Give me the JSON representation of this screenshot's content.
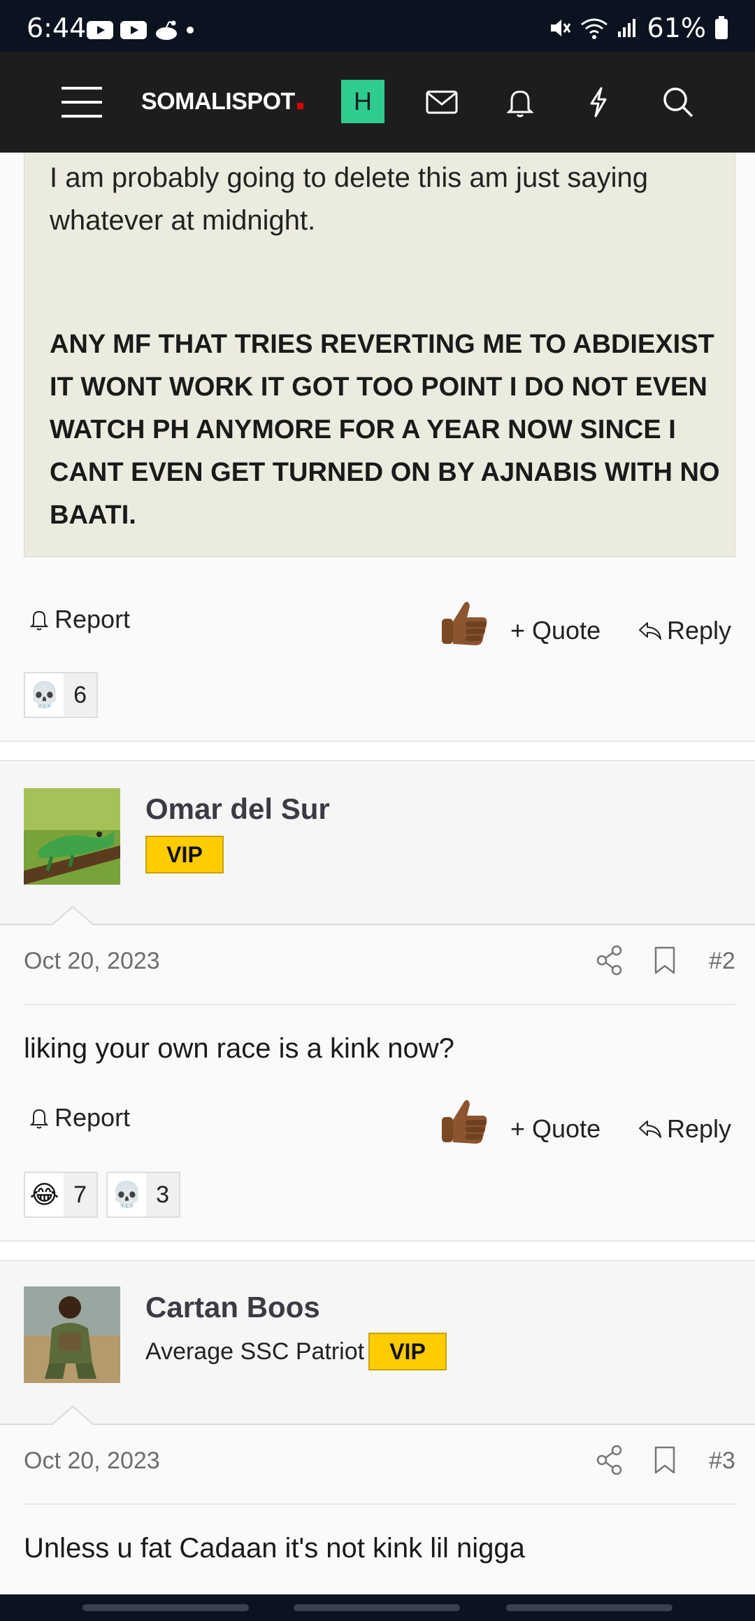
{
  "status_bar": {
    "time": "6:44",
    "battery": "61%",
    "left_icons": [
      "youtube-icon",
      "youtube-icon",
      "reddit-icon",
      "dot-icon"
    ],
    "right_icons": [
      "mute-icon",
      "wifi-icon",
      "signal-icon",
      "battery-icon"
    ]
  },
  "header": {
    "brand": "SOMALISPOT",
    "badge": "H",
    "icons": [
      "menu-icon",
      "mail-icon",
      "bell-icon",
      "lightning-icon",
      "search-icon"
    ]
  },
  "post1": {
    "text_plain": "I am probably going to delete this am just saying whatever at midnight.",
    "text_bold": "ANY MF THAT TRIES REVERTING ME TO ABDIEXIST IT WONT WORK IT GOT TOO POINT I DO NOT EVEN WATCH PH ANYMORE FOR A YEAR NOW SINCE I CANT EVEN GET TURNED ON BY AJNABIS WITH NO BAATI.",
    "actions": {
      "report": "Report",
      "quote": "Quote",
      "reply": "Reply"
    },
    "reactions": [
      {
        "emoji": "💀",
        "count": "6"
      }
    ]
  },
  "post2": {
    "username": "Omar del Sur",
    "badge": "VIP",
    "date": "Oct 20, 2023",
    "number": "#2",
    "text": "liking your own race is a kink now?",
    "actions": {
      "report": "Report",
      "quote": "Quote",
      "reply": "Reply"
    },
    "reactions": [
      {
        "emoji": "😂",
        "count": "7"
      },
      {
        "emoji": "💀",
        "count": "3"
      }
    ]
  },
  "post3": {
    "username": "Cartan Boos",
    "user_title": "Average SSC Patriot",
    "badge": "VIP",
    "date": "Oct 20, 2023",
    "number": "#3",
    "text": "Unless u fat Cadaan it's not kink lil nigga"
  },
  "colors": {
    "header_bg": "#1d1d1d",
    "status_bg": "#0c1320",
    "badge_green": "#2ecc8f",
    "vip_yellow": "#ffcc00",
    "quote_bg": "#ecebdf"
  }
}
